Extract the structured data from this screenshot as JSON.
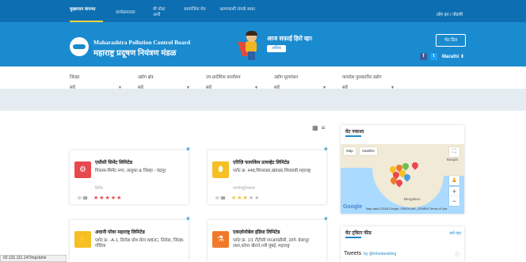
{
  "nav": {
    "items": [
      "मुख्यपान कंपन्या",
      "कार्यक्रमातल",
      "मी पोस्ट अशी",
      "सामाजिक मेघ",
      "आमच्याशी संपर्क साधा"
    ],
    "login": "लॉग इन / नोंदणी"
  },
  "header": {
    "org_en": "Maharashtra Pollution Control Board",
    "org_mr": "महाराष्ट्र प्रदूषण नियंत्रण मंडळ",
    "tagline": "आज सफ़ाई हिरो व्हा!",
    "tag_badge": "अधिक",
    "visit_button": "भेट दिल",
    "language": "Marathi ⇕"
  },
  "filters": [
    {
      "label": "जिल्हा",
      "value": "सर्व"
    },
    {
      "label": "उद्योग क्षेत्र",
      "value": "सर्व"
    },
    {
      "label": "उप-प्रादेशिक कार्यालय",
      "value": "सर्व"
    },
    {
      "label": "उद्योग मूल्यांकन",
      "value": "सर्व"
    },
    {
      "label": "फायदेश पुरस्कारीत उद्योग",
      "value": "सर्व"
    }
  ],
  "cards": [
    {
      "name": "एसीसी सिमेंट लिमिटेड",
      "address": "विकास-सिमेंट नगर, तालुका & जिल्हा - चंद्रपूर",
      "city": "सिमेंट",
      "stars": 5,
      "icon_color": "#e8484d",
      "icon": "gear-icon"
    },
    {
      "name": "एरिज़ि फार्माकेम प्रायव्हेट लिमिटेड",
      "address": "प्लॉट क्र. 448,शिरसाळा,खंडाळा,शिवडाबी,महाराष्ट्र",
      "city": "फार्मास्युटिकल्स",
      "stars": 3,
      "icon_color": "#f6bf24",
      "icon": "pill-icon"
    },
    {
      "name": "अदानी पॉवर महाराष्ट्र लिमिटेड",
      "address": "प्लॉट क्र. -A-1, तिरोडा ग्रोथ सेंटर MIDC, तिरोडा, जिल्हा-गोंदिया",
      "city": "",
      "stars": 0,
      "icon_color": "#f6bf24",
      "icon": "plug-icon"
    },
    {
      "name": "एकज़ोनोबेल इंडिया लिमिटेड",
      "address": "प्लॉट क्र. 1/1 टीटीसी एमआयडीसी, ठाणे- बेलापूर रस्ता,कोपर खैराने,नवी मुंबई, महाराष्ट्र",
      "city": "",
      "stars": 0,
      "icon_color": "#f07a29",
      "icon": "flask-icon"
    }
  ],
  "map": {
    "title": "घेट नकाशा",
    "tab_map": "Map",
    "tab_sat": "Satellite",
    "place_bangla": "Bangla",
    "place_blore": "Bengaluru",
    "google": "Google",
    "credit": "Map data ©2018 Google, ORION-ME, ZENRIN   Terms of Use"
  },
  "twitter": {
    "title": "घेट ट्विटर फीड",
    "more": "सर्व पहा",
    "tweets": "Tweets",
    "by": "by @mheitansiling"
  },
  "status_url": "02.131.111.147/mpcb/mr"
}
